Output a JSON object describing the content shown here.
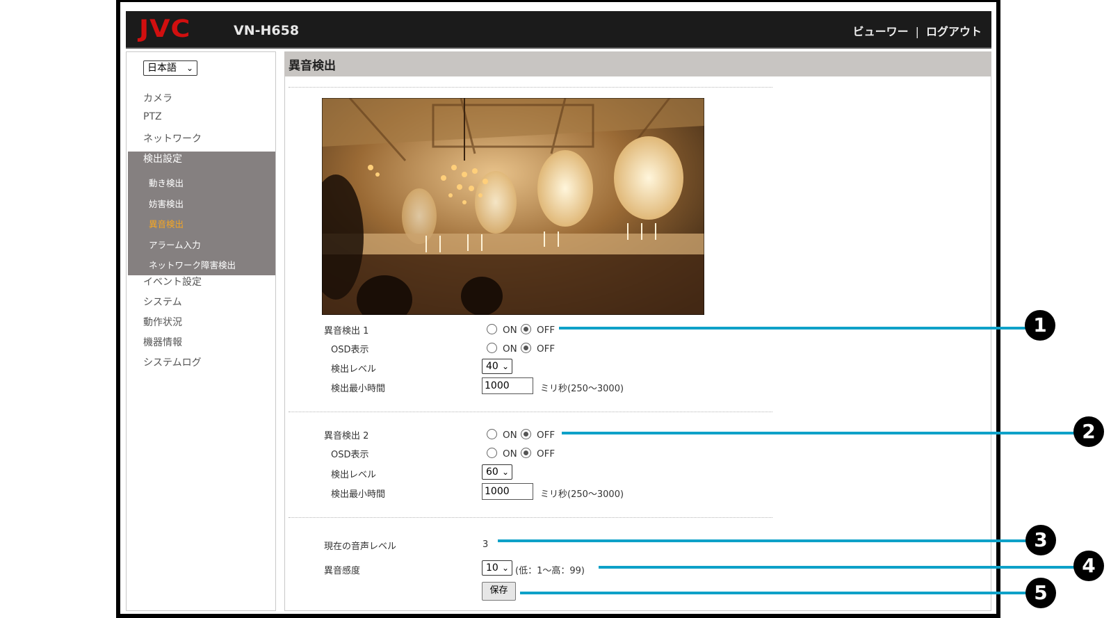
{
  "header": {
    "logo": "JVC",
    "model": "VN-H658",
    "links": [
      "ビューワー",
      "ログアウト"
    ],
    "separator": "|"
  },
  "sidebar": {
    "language": "日本語",
    "items": [
      {
        "label": "カメラ"
      },
      {
        "label": "PTZ"
      },
      {
        "label": "ネットワーク"
      },
      {
        "label": "検出設定"
      },
      {
        "label": "イベント設定"
      },
      {
        "label": "システム"
      },
      {
        "label": "動作状況"
      },
      {
        "label": "機器情報"
      },
      {
        "label": "システムログ"
      }
    ],
    "subitems": [
      {
        "label": "動き検出",
        "active": false
      },
      {
        "label": "妨害検出",
        "active": false
      },
      {
        "label": "異音検出",
        "active": true
      },
      {
        "label": "アラーム入力",
        "active": false
      },
      {
        "label": "ネットワーク障害検出",
        "active": false
      }
    ]
  },
  "main": {
    "title": "異音検出",
    "detection1": {
      "label": "異音検出 1",
      "on_label": "ON",
      "off_label": "OFF",
      "value": "OFF",
      "osd_label": "OSD表示",
      "osd_on": "ON",
      "osd_off": "OFF",
      "osd_value": "OFF",
      "level_label": "検出レベル",
      "level_value": "40",
      "time_label": "検出最小時間",
      "time_value": "1000",
      "time_unit": "ミリ秒(250〜3000)"
    },
    "detection2": {
      "label": "異音検出 2",
      "on_label": "ON",
      "off_label": "OFF",
      "value": "OFF",
      "osd_label": "OSD表示",
      "osd_on": "ON",
      "osd_off": "OFF",
      "osd_value": "OFF",
      "level_label": "検出レベル",
      "level_value": "60",
      "time_label": "検出最小時間",
      "time_value": "1000",
      "time_unit": "ミリ秒(250〜3000)"
    },
    "current_level_label": "現在の音声レベル",
    "current_level_value": "3",
    "sensitivity_label": "異音感度",
    "sensitivity_value": "10",
    "sensitivity_range": "(低：1〜高：99)",
    "save_label": "保存"
  },
  "callouts": [
    "1",
    "2",
    "3",
    "4",
    "5"
  ],
  "colors": {
    "accent": "#0ea1c8",
    "logo": "#d10f0f",
    "active": "#f5a623"
  }
}
